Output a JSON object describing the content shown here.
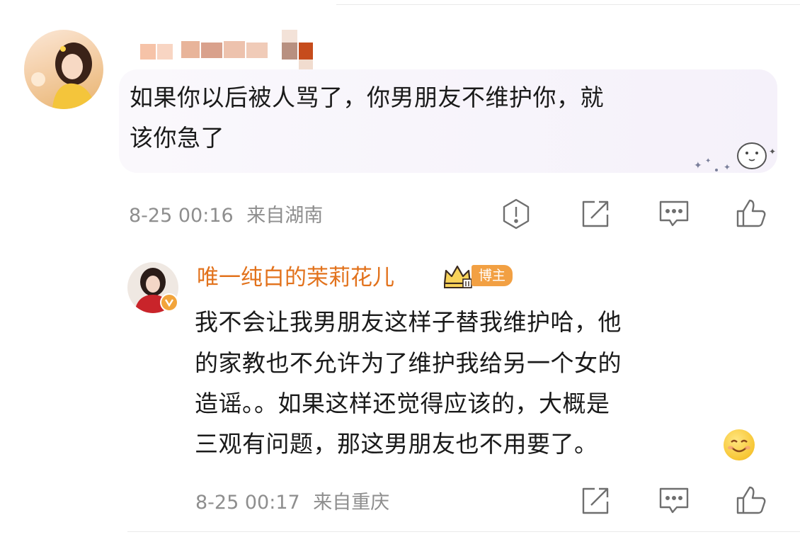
{
  "comment": {
    "text_line1": "如果你以后被人骂了，你男朋友不维护你，就",
    "text_line2": "该你急了",
    "date": "8-25 00:16",
    "location": "来自湖南",
    "icons": [
      "report-icon",
      "share-icon",
      "comment-icon",
      "like-icon"
    ]
  },
  "reply": {
    "username": "唯一纯白的茉莉花儿",
    "badge": "博主",
    "text_lines": [
      "我不会让我男朋友这样子替我维护哈，他",
      "的家教也不允许为了维护我给另一个女的",
      "造谣。。如果这样还觉得应该的，大概是",
      "三观有问题，那这男朋友也不用要了。"
    ],
    "emoji": "smile-emoji",
    "date": "8-25 00:17",
    "location": "来自重庆",
    "icons": [
      "share-icon",
      "comment-icon",
      "like-icon"
    ]
  },
  "colors": {
    "username": "#e2721c",
    "badge": "#f2a043",
    "meta": "#8e8e8e",
    "bubble": "#f6f2fa"
  }
}
